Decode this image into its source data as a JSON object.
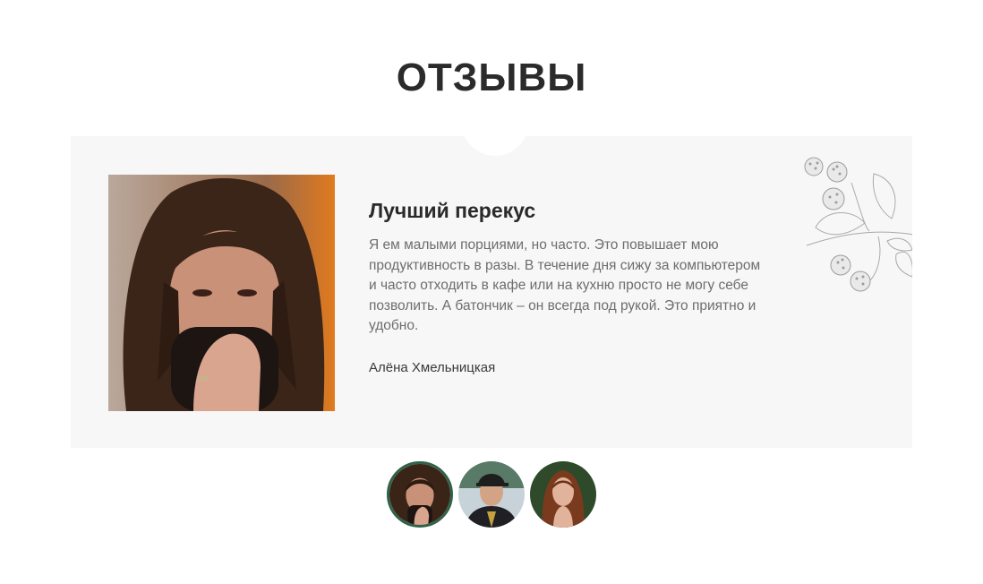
{
  "section": {
    "title": "ОТЗЫВЫ"
  },
  "review": {
    "title": "Лучший перекус",
    "text": "Я ем малыми порциями, но часто. Это повышает мою продуктивность в разы. В течение дня сижу за компьютером и часто отходить в кафе или на кухню просто не могу себе позволить. А батончик – он всегда под рукой. Это приятно и удобно.",
    "author": "Алёна Хмельницкая"
  },
  "thumbnails": {
    "active_index": 0,
    "items": [
      {
        "icon": "avatar-woman-dark-hair-icon"
      },
      {
        "icon": "avatar-man-cap-icon"
      },
      {
        "icon": "avatar-woman-red-hair-icon"
      }
    ]
  },
  "colors": {
    "active_ring": "#2f6246",
    "card_background": "#f6f7f6",
    "title": "#2b2b2b",
    "body_text": "#6d6d6d"
  }
}
